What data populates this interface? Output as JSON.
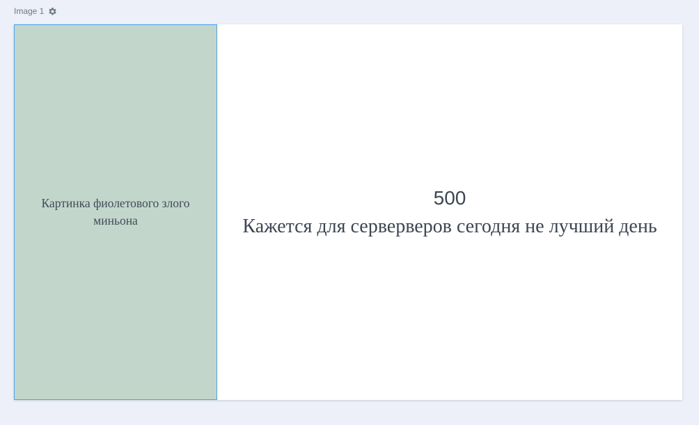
{
  "frame": {
    "title": "Image 1",
    "settings_icon": "gear-icon"
  },
  "image_placeholder": {
    "text": "Картинка фиолетового злого миньона"
  },
  "error": {
    "code": "500",
    "message": "Кажется для серверверов сегодня не лучший день"
  },
  "colors": {
    "page_background": "#edf0f8",
    "canvas_background": "#ffffff",
    "placeholder_fill": "#c3d6cb",
    "selection_border": "#4aa3ea",
    "text": "#3d4652"
  }
}
